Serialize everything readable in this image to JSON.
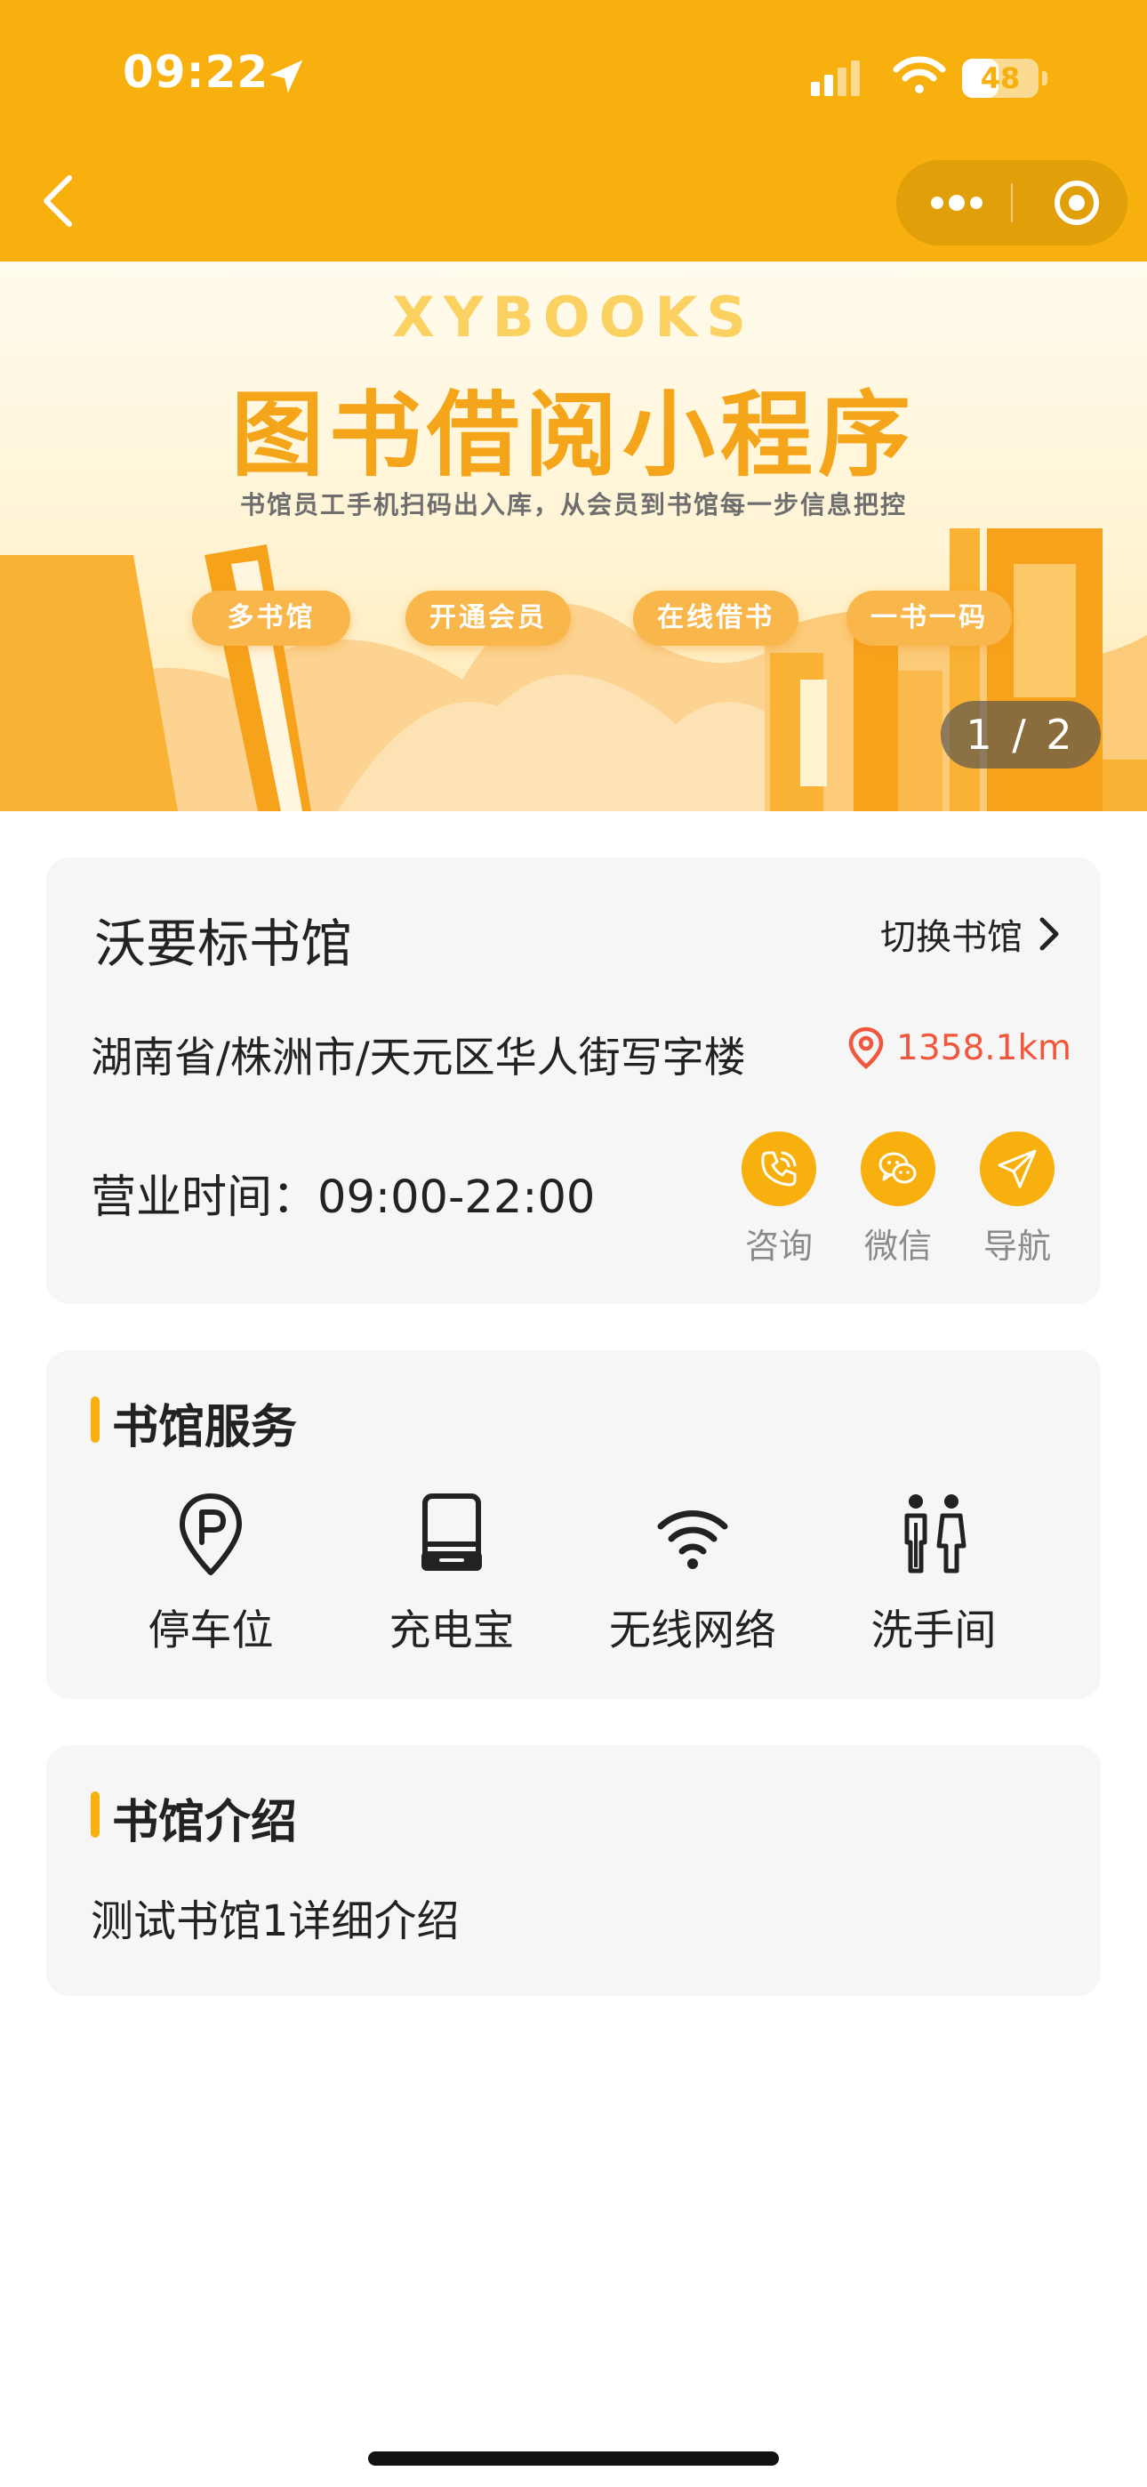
{
  "status_bar": {
    "time": "09:22",
    "battery": "48",
    "battery_level": 0.48
  },
  "banner": {
    "brand": "XYBOOKS",
    "title": "图书借阅小程序",
    "subtitle": "书馆员工手机扫码出入库，从会员到书馆每一步信息把控",
    "tags": [
      "多书馆",
      "开通会员",
      "在线借书",
      "一书一码"
    ],
    "pager": "1 / 2"
  },
  "library": {
    "name": "沃要标书馆",
    "switch_label": "切换书馆",
    "address": "湖南省/株洲市/天元区华人街写字楼",
    "distance": "1358.1km",
    "hours": "营业时间：09:00-22:00",
    "actions": [
      {
        "label": "咨询",
        "icon": "phone-icon"
      },
      {
        "label": "微信",
        "icon": "wechat-icon"
      },
      {
        "label": "导航",
        "icon": "navigation-icon"
      }
    ]
  },
  "services": {
    "title": "书馆服务",
    "items": [
      {
        "label": "停车位",
        "icon": "parking-icon"
      },
      {
        "label": "充电宝",
        "icon": "power-bank-icon"
      },
      {
        "label": "无线网络",
        "icon": "wifi-icon"
      },
      {
        "label": "洗手间",
        "icon": "restroom-icon"
      }
    ]
  },
  "intro": {
    "title": "书馆介绍",
    "text": "测试书馆1详细介绍"
  },
  "colors": {
    "accent": "#f7b00e",
    "distance": "#f0573c",
    "card_bg": "#f6f6f6",
    "muted": "#8a8a8a"
  }
}
